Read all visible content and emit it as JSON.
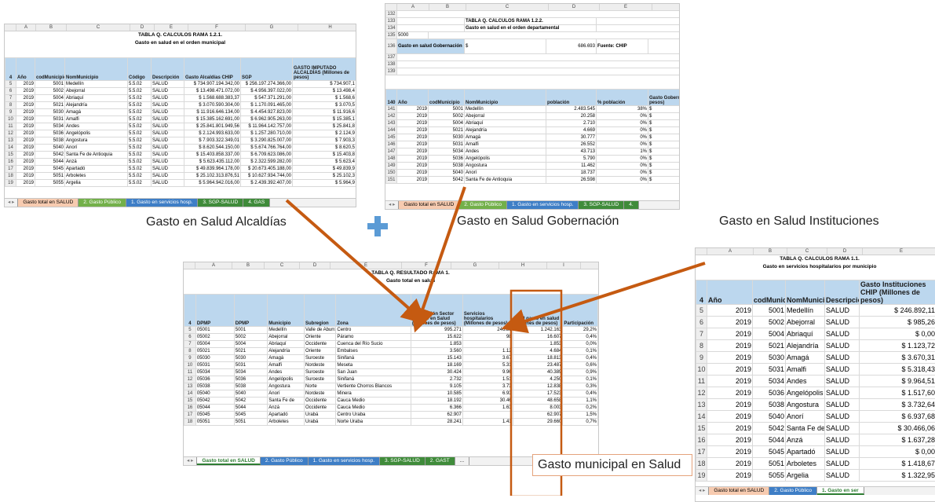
{
  "sheet_alcaldias": {
    "columns": [
      "A",
      "B",
      "C",
      "D",
      "E",
      "F",
      "G",
      "H"
    ],
    "title1": "TABLA Q. CALCULOS RAMA 1.2.1.",
    "title2": "Gasto en salud en el orden municipal",
    "headers": [
      "Año",
      "codMunicipio",
      "NomMunicipio",
      "Código",
      "Descripción",
      "Gasto Alcaldías CHIP",
      "SGP",
      "GASTO IMPUTADO ALCALDÍAS (Millones de pesos)"
    ],
    "rows": [
      [
        "5",
        "2019",
        "5001",
        "Medellín",
        "5.5.02",
        "SALUD",
        "$ 734.907.194.342,00",
        "$ 256.197.274.366,00",
        "$ 734.907,1"
      ],
      [
        "6",
        "2019",
        "5002",
        "Abejorral",
        "5.5.02",
        "SALUD",
        "$ 13.498.471.072,00",
        "$ 4.956.397.022,00",
        "$ 13.498,4"
      ],
      [
        "7",
        "2019",
        "5004",
        "Abriaquí",
        "5.5.02",
        "SALUD",
        "$ 1.568.688.383,37",
        "$ 547.371.291,00",
        "$ 1.568,6"
      ],
      [
        "8",
        "2019",
        "5021",
        "Alejandría",
        "5.5.02",
        "SALUD",
        "$ 3.070.590.304,00",
        "$ 1.170.091.465,00",
        "$ 3.070,5"
      ],
      [
        "9",
        "2019",
        "5030",
        "Amagá",
        "5.5.02",
        "SALUD",
        "$ 11.916.646.134,00",
        "$ 4.454.927.823,00",
        "$ 11.916,6"
      ],
      [
        "10",
        "2019",
        "5031",
        "Amalfi",
        "5.5.02",
        "SALUD",
        "$ 15.385.162.691,00",
        "$ 6.962.905.263,00",
        "$ 15.385,1"
      ],
      [
        "11",
        "2019",
        "5034",
        "Andes",
        "5.5.02",
        "SALUD",
        "$ 25.841.801.949,56",
        "$ 11.964.142.757,00",
        "$ 25.841,8"
      ],
      [
        "12",
        "2019",
        "5036",
        "Angelópolis",
        "5.5.02",
        "SALUD",
        "$ 2.124.993.633,00",
        "$ 1.257.280.710,00",
        "$ 2.124,9"
      ],
      [
        "13",
        "2019",
        "5038",
        "Angostura",
        "5.5.02",
        "SALUD",
        "$ 7.903.322.349,01",
        "$ 3.290.825.007,00",
        "$ 7.903,3"
      ],
      [
        "14",
        "2019",
        "5040",
        "Anorí",
        "5.5.02",
        "SALUD",
        "$ 8.620.544.150,00",
        "$ 5.674.766.764,00",
        "$ 8.620,5"
      ],
      [
        "15",
        "2019",
        "5042",
        "Santa Fe de Antioquia",
        "5.5.02",
        "SALUD",
        "$ 15.403.858.337,00",
        "$ 6.709.623.086,00",
        "$ 15.403,8"
      ],
      [
        "16",
        "2019",
        "5044",
        "Anzá",
        "5.5.02",
        "SALUD",
        "$ 5.623.435.112,00",
        "$ 2.322.599.282,00",
        "$ 5.623,4"
      ],
      [
        "17",
        "2019",
        "5045",
        "Apartadó",
        "5.5.02",
        "SALUD",
        "$ 49.839.964.178,00",
        "$ 20.673.405.188,00",
        "$ 49.839,9"
      ],
      [
        "18",
        "2019",
        "5051",
        "Arboletes",
        "5.5.02",
        "SALUD",
        "$ 25.102.313.876,51",
        "$ 10.627.934.744,00",
        "$ 25.102,3"
      ],
      [
        "19",
        "2019",
        "5055",
        "Argelia",
        "5.5.02",
        "SALUD",
        "$ 5.964.942.016,00",
        "$ 2.439.392.407,00",
        "$ 5.964,9"
      ]
    ],
    "tabs": [
      "Gasto total en SALUD",
      "2. Gasto Público",
      "1. Gasto en servicios hosp.",
      "3. SGP-SALUD",
      "4. GAS"
    ]
  },
  "sheet_gobernacion": {
    "columns": [
      "A",
      "B",
      "C",
      "D",
      "E",
      "F"
    ],
    "title1": "TABLA Q. CALCULOS RAMA 1.2.2.",
    "title2": "Gasto en salud en el orden departamental",
    "code": "5000",
    "gasto_label": "Gasto en salud Gobernación",
    "gasto_currency": "$",
    "gasto_value": "686.693",
    "fuente": "Fuente: CHIP",
    "pre_rows": [
      "132",
      "133",
      "134",
      "135",
      "136",
      "137",
      "138",
      "139"
    ],
    "headers": [
      "Año",
      "codMunicipio",
      "NomMunicipio",
      "población",
      "% población",
      "Gasto Gobernación (Millones de pesos)"
    ],
    "rows": [
      [
        "141",
        "2019",
        "5001",
        "Medellín",
        "2.483.545",
        "38%",
        "$",
        "260.363"
      ],
      [
        "142",
        "2019",
        "5002",
        "Abejorral",
        "20.258",
        "0%",
        "$",
        "2.124"
      ],
      [
        "143",
        "2019",
        "5004",
        "Abriaquí",
        "2.710",
        "0%",
        "$",
        "284"
      ],
      [
        "144",
        "2019",
        "5021",
        "Alejandría",
        "4.669",
        "0%",
        "$",
        "489"
      ],
      [
        "145",
        "2019",
        "5030",
        "Amagá",
        "30.777",
        "0%",
        "$",
        "3.227"
      ],
      [
        "146",
        "2019",
        "5031",
        "Amalfi",
        "26.552",
        "0%",
        "$",
        "2.784"
      ],
      [
        "147",
        "2019",
        "5034",
        "Andes",
        "43.713",
        "1%",
        "$",
        "4.583"
      ],
      [
        "148",
        "2019",
        "5036",
        "Angelópolis",
        "5.790",
        "0%",
        "$",
        "607"
      ],
      [
        "149",
        "2019",
        "5038",
        "Angostura",
        "11.462",
        "0%",
        "$",
        "1.202"
      ],
      [
        "150",
        "2019",
        "5040",
        "Anorí",
        "18.737",
        "0%",
        "$",
        "1.964"
      ],
      [
        "151",
        "2019",
        "5042",
        "Santa Fe de Antioquia",
        "26.598",
        "0%",
        "$",
        "2.788"
      ]
    ],
    "tabs": [
      "Gasto total en SALUD",
      "2. Gasto Público",
      "1. Gasto en servicios hosp.",
      "3. SGP-SALUD",
      "4."
    ]
  },
  "sheet_resultado": {
    "columns": [
      "A",
      "B",
      "C",
      "D",
      "E",
      "F",
      "G",
      "H",
      "I"
    ],
    "title1": "TABLA Q. RESULTADO RAMA 1.",
    "title2": "Gasto total en salud",
    "headers": [
      "DPMP",
      "DPMP",
      "Municipio",
      "Subregion",
      "Zona",
      "Producción Sector público en Salud (Millones de pesos)",
      "Servicios hospitalarios (Millones de pesos)",
      "Total gasto en salud (Millones de pesos)",
      "Participación"
    ],
    "rows": [
      [
        "5",
        "05001",
        "5001",
        "Medellín",
        "Valle de Aburrá",
        "Centro",
        "995.271",
        "246.89",
        "1.242.163",
        "29,2%"
      ],
      [
        "6",
        "05002",
        "5002",
        "Abejorral",
        "Oriente",
        "Páramo",
        "15.622",
        "98",
        "16.607",
        "0,4%"
      ],
      [
        "7",
        "05004",
        "5004",
        "Abriaquí",
        "Occidente",
        "Cuenca del Río Sucio",
        "1.853",
        "",
        "1.853",
        "0,0%"
      ],
      [
        "8",
        "05021",
        "5021",
        "Alejandría",
        "Oriente",
        "Embalses",
        "3.560",
        "1.12",
        "4.684",
        "0,1%"
      ],
      [
        "9",
        "05030",
        "5030",
        "Amagá",
        "Suroeste",
        "Sinifaná",
        "15.143",
        "3.67",
        "18.813",
        "0,4%"
      ],
      [
        "10",
        "05031",
        "5031",
        "Amalfi",
        "Nordeste",
        "Meseta",
        "18.169",
        "5.31",
        "23.487",
        "0,6%"
      ],
      [
        "11",
        "05034",
        "5034",
        "Andes",
        "Suroeste",
        "San Juan",
        "30.424",
        "9.96",
        "40.389",
        "0,9%"
      ],
      [
        "12",
        "05036",
        "5036",
        "Angelópolis",
        "Suroeste",
        "Sinifaná",
        "2.732",
        "1.51",
        "4.250",
        "0,1%"
      ],
      [
        "13",
        "05038",
        "5038",
        "Angostura",
        "Norte",
        "Vertiente Chorros Blancos",
        "9.105",
        "3.73",
        "12.838",
        "0,3%"
      ],
      [
        "14",
        "05040",
        "5040",
        "Anorí",
        "Nordeste",
        "Minera",
        "10.585",
        "6.93",
        "17.523",
        "0,4%"
      ],
      [
        "15",
        "05042",
        "5042",
        "Santa Fe de",
        "Occidente",
        "Cauca Medio",
        "18.192",
        "30.46",
        "48.658",
        "1,1%"
      ],
      [
        "16",
        "05044",
        "5044",
        "Anzá",
        "Occidente",
        "Cauca Medio",
        "6.366",
        "1.63",
        "8.003",
        "0,2%"
      ],
      [
        "17",
        "05045",
        "5045",
        "Apartadó",
        "Urabá",
        "Centro Uraba",
        "62.907",
        "",
        "62.907",
        "1,5%"
      ],
      [
        "18",
        "05051",
        "5051",
        "Arboletes",
        "Urabá",
        "Norte Uraba",
        "28.241",
        "1.41",
        "29.660",
        "0,7%"
      ]
    ],
    "tabs": [
      "Gasto total en SALUD",
      "2. Gasto Público",
      "1. Gasto en servicios hosp.",
      "3. SGP-SALUD",
      "2. GAST",
      "..."
    ]
  },
  "sheet_instituciones": {
    "columns": [
      "A",
      "B",
      "C",
      "D",
      "E"
    ],
    "title1": "TABLA Q. CALCULOS RAMA 1.1.",
    "title2": "Gasto en servicios hospitalarios por municipio",
    "headers": [
      "Año",
      "codMunicipio",
      "NomMunicipio",
      "Descripción",
      "Gasto Instituciones CHIP (Millones de pesos)"
    ],
    "rows": [
      [
        "5",
        "2019",
        "5001",
        "Medellín",
        "SALUD",
        "$ 246.892,11"
      ],
      [
        "6",
        "2019",
        "5002",
        "Abejorral",
        "SALUD",
        "$ 985,26"
      ],
      [
        "7",
        "2019",
        "5004",
        "Abriaquí",
        "SALUD",
        "$ 0,00"
      ],
      [
        "8",
        "2019",
        "5021",
        "Alejandría",
        "SALUD",
        "$ 1.123,72"
      ],
      [
        "9",
        "2019",
        "5030",
        "Amagá",
        "SALUD",
        "$ 3.670,31"
      ],
      [
        "10",
        "2019",
        "5031",
        "Amalfi",
        "SALUD",
        "$ 5.318,43"
      ],
      [
        "11",
        "2019",
        "5034",
        "Andes",
        "SALUD",
        "$ 9.964,51"
      ],
      [
        "12",
        "2019",
        "5036",
        "Angelópolis",
        "SALUD",
        "$ 1.517,60"
      ],
      [
        "13",
        "2019",
        "5038",
        "Angostura",
        "SALUD",
        "$ 3.732,64"
      ],
      [
        "14",
        "2019",
        "5040",
        "Anorí",
        "SALUD",
        "$ 6.937,68"
      ],
      [
        "15",
        "2019",
        "5042",
        "Santa Fe de A",
        "SALUD",
        "$ 30.466,06"
      ],
      [
        "16",
        "2019",
        "5044",
        "Anzá",
        "SALUD",
        "$ 1.637,28"
      ],
      [
        "17",
        "2019",
        "5045",
        "Apartadó",
        "SALUD",
        "$ 0,00"
      ],
      [
        "18",
        "2019",
        "5051",
        "Arboletes",
        "SALUD",
        "$ 1.418,67"
      ],
      [
        "19",
        "2019",
        "5055",
        "Argelia",
        "SALUD",
        "$ 1.322,95"
      ]
    ],
    "tabs": [
      "Gasto total en SALUD",
      "2. Gasto Público",
      "1. Gasto en ser"
    ]
  },
  "captions": {
    "alcaldias": "Gasto en Salud Alcaldías",
    "gobernacion": "Gasto en Salud Gobernación",
    "instituciones": "Gasto en Salud Instituciones",
    "municipal": "Gasto municipal en Salud"
  },
  "colors": {
    "arrow": "#c55a11",
    "plus": "#5b9bd5",
    "header_fill": "#bcd7ee",
    "tab_green": "#73b04a",
    "tab_blue": "#3e7ec6",
    "tab_salmon": "#f7cbb0"
  }
}
